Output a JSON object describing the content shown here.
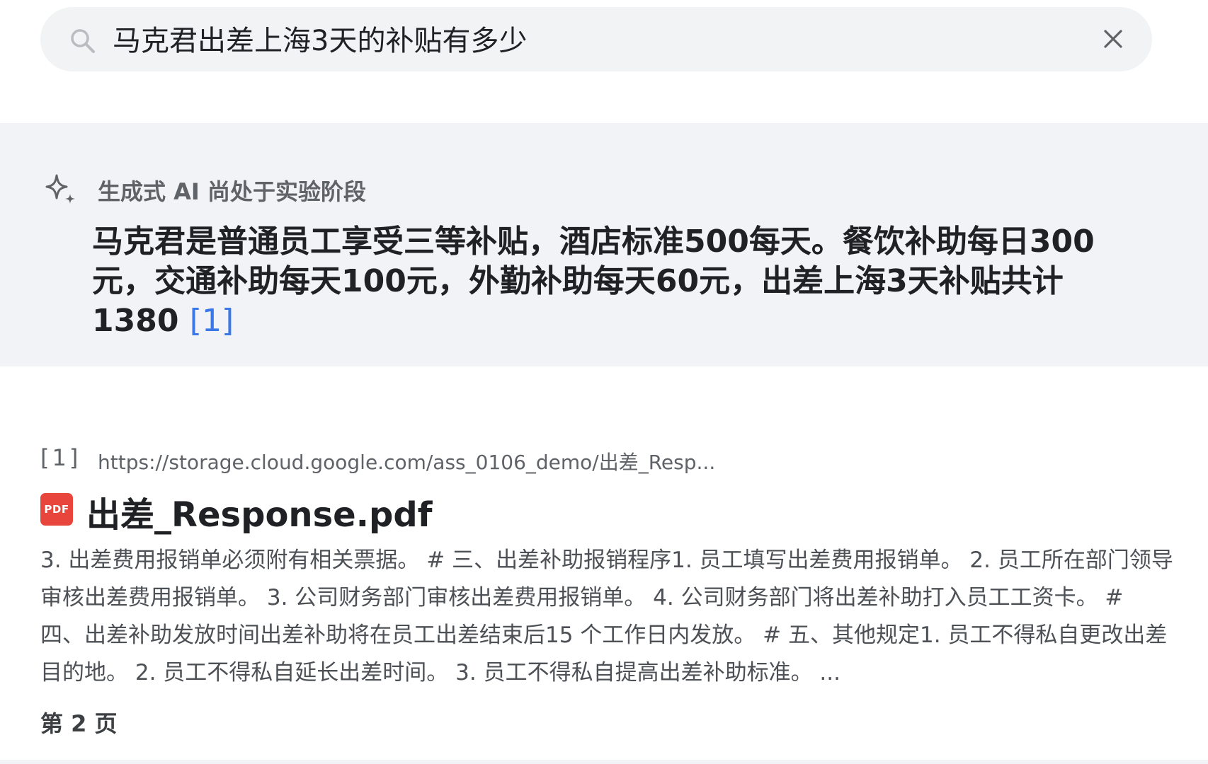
{
  "search": {
    "query": "马克君出差上海3天的补贴有多少"
  },
  "ai_overview": {
    "notice": "生成式 AI 尚处于实验阶段",
    "answer": "马克君是普通员工享受三等补贴，酒店标准500每天。餐饮补助每日300元，交通补助每天100元，外勤补助每天60元，出差上海3天补贴共计1380",
    "citation": "[1]"
  },
  "results": [
    {
      "index": "[1]",
      "url": "https://storage.cloud.google.com/ass_0106_demo/出差_Resp...",
      "file_badge": "PDF",
      "title": "出差_Response.pdf",
      "snippet": "3. 出差费用报销单必须附有相关票据。 # 三、出差补助报销程序1. 员工填写出差费用报销单。 2. 员工所在部门领导审核出差费用报销单。 3. 公司财务部门审核出差费用报销单。 4. 公司财务部门将出差补助打入员工工资卡。 # 四、出差补助发放时间出差补助将在员工出差结束后15 个工作日内发放。 # 五、其他规定1. 员工不得私自更改出差目的地。 2. 员工不得私自延长出差时间。 3. 员工不得私自提高出差补助标准。 ...",
      "page": "第 2 页"
    }
  ],
  "icons": {
    "search": "search-icon",
    "clear": "close-icon",
    "ai": "sparkle-icon",
    "file": "pdf-icon"
  },
  "colors": {
    "search_bg": "#f1f3f4",
    "ai_panel_bg": "#f1f3f7",
    "citation": "#3b78e7",
    "pdf_badge": "#e8453c"
  }
}
